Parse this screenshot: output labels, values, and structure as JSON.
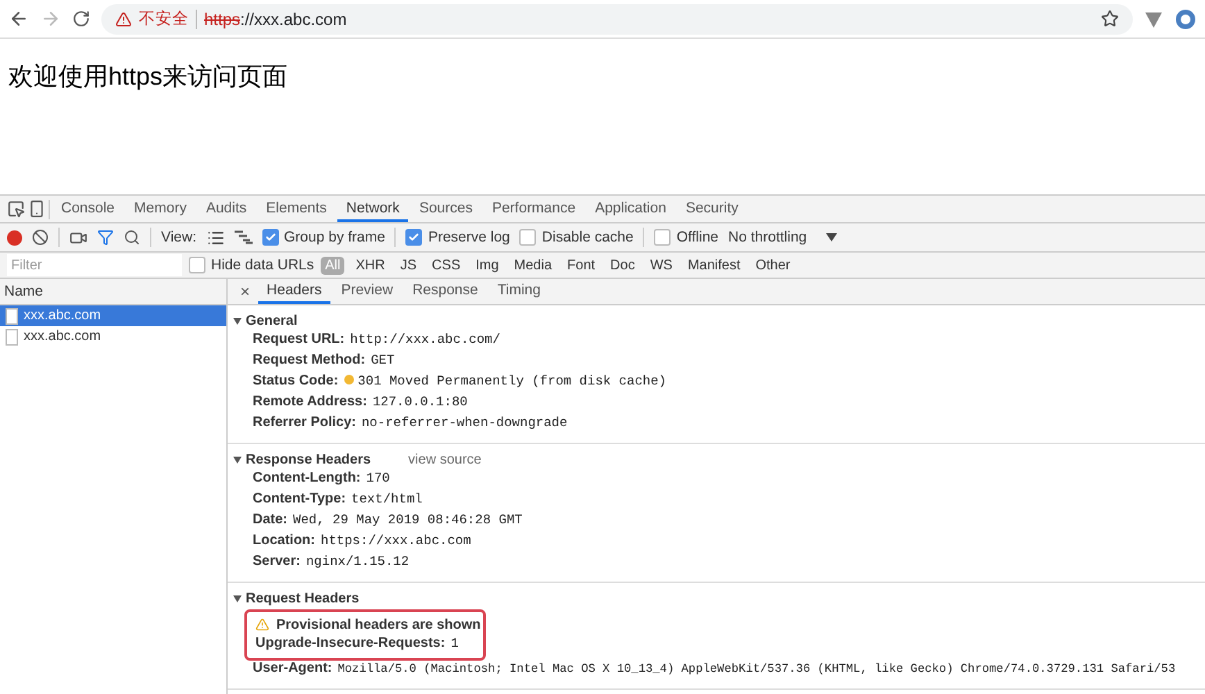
{
  "browser": {
    "security_label": "不安全",
    "url_scheme": "https",
    "url_rest": "://xxx.abc.com"
  },
  "page": {
    "heading": "欢迎使用https来访问页面"
  },
  "devtools": {
    "tabs": [
      {
        "label": "Console",
        "selected": false
      },
      {
        "label": "Memory",
        "selected": false
      },
      {
        "label": "Audits",
        "selected": false
      },
      {
        "label": "Elements",
        "selected": false
      },
      {
        "label": "Network",
        "selected": true
      },
      {
        "label": "Sources",
        "selected": false
      },
      {
        "label": "Performance",
        "selected": false
      },
      {
        "label": "Application",
        "selected": false
      },
      {
        "label": "Security",
        "selected": false
      }
    ],
    "toolbar": {
      "recording": true,
      "view_label": "View:",
      "options": [
        {
          "label": "Group by frame",
          "checked": true
        },
        {
          "label": "Preserve log",
          "checked": true
        },
        {
          "label": "Disable cache",
          "checked": false
        },
        {
          "label": "Offline",
          "checked": false
        }
      ],
      "throttling": "No throttling"
    },
    "filter": {
      "placeholder": "Filter",
      "hide_data_urls": {
        "label": "Hide data URLs",
        "checked": false
      },
      "types": [
        {
          "label": "All",
          "selected": true
        },
        {
          "label": "XHR",
          "selected": false
        },
        {
          "label": "JS",
          "selected": false
        },
        {
          "label": "CSS",
          "selected": false
        },
        {
          "label": "Img",
          "selected": false
        },
        {
          "label": "Media",
          "selected": false
        },
        {
          "label": "Font",
          "selected": false
        },
        {
          "label": "Doc",
          "selected": false
        },
        {
          "label": "WS",
          "selected": false
        },
        {
          "label": "Manifest",
          "selected": false
        },
        {
          "label": "Other",
          "selected": false
        }
      ]
    },
    "requests": {
      "column": "Name",
      "rows": [
        {
          "name": "xxx.abc.com",
          "selected": true
        },
        {
          "name": "xxx.abc.com",
          "selected": false
        }
      ]
    },
    "detail": {
      "close": "×",
      "tabs": [
        {
          "label": "Headers",
          "selected": true
        },
        {
          "label": "Preview",
          "selected": false
        },
        {
          "label": "Response",
          "selected": false
        },
        {
          "label": "Timing",
          "selected": false
        }
      ],
      "sections": [
        {
          "title": "General",
          "expanded": true,
          "headers": [
            {
              "key": "Request URL:",
              "value": "http://xxx.abc.com/"
            },
            {
              "key": "Request Method:",
              "value": "GET"
            },
            {
              "key": "Status Code:",
              "value": "301 Moved Permanently (from disk cache)",
              "color": "#f2b833"
            },
            {
              "key": "Remote Address:",
              "value": "127.0.0.1:80"
            },
            {
              "key": "Referrer Policy:",
              "value": "no-referrer-when-downgrade"
            }
          ]
        },
        {
          "title": "Response Headers",
          "expanded": true,
          "action": "view source",
          "headers": [
            {
              "key": "Content-Length:",
              "value": "170"
            },
            {
              "key": "Content-Type:",
              "value": "text/html"
            },
            {
              "key": "Date:",
              "value": "Wed, 29 May 2019 08:46:28 GMT"
            },
            {
              "key": "Location:",
              "value": "https://xxx.abc.com"
            },
            {
              "key": "Server:",
              "value": "nginx/1.15.12"
            }
          ]
        },
        {
          "title": "Request Headers",
          "expanded": true,
          "highlight_box": {
            "notice": "Provisional headers are shown",
            "headers": [
              {
                "key": "Upgrade-Insecure-Requests:",
                "value": "1"
              }
            ]
          },
          "headers": [
            {
              "key": "User-Agent:",
              "value": "Mozilla/5.0 (Macintosh; Intel Mac OS X 10_13_4) AppleWebKit/537.36 (KHTML, like Gecko) Chrome/74.0.3729.131 Safari/53"
            }
          ]
        }
      ]
    }
  }
}
